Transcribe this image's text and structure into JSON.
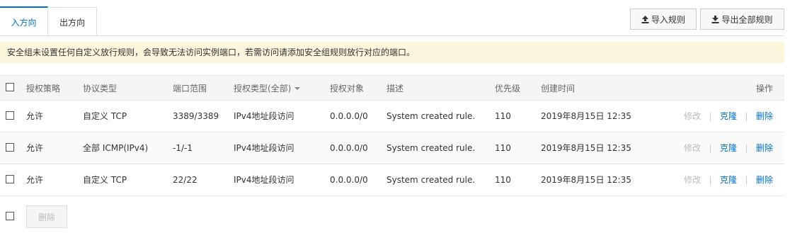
{
  "tabs": [
    {
      "label": "入方向",
      "active": true
    },
    {
      "label": "出方向",
      "active": false
    }
  ],
  "toolbar": {
    "import_label": "导入规则",
    "export_label": "导出全部规则"
  },
  "notice": {
    "text": "安全组未设置任何自定义放行规则，会导致无法访问实例端口，若需访问请添加安全组规则放行对应的端口。",
    "background": "#fdf5dc"
  },
  "table": {
    "headers": {
      "policy": "授权策略",
      "protocol": "协议类型",
      "port": "端口范围",
      "auth_type": "授权类型(全部)",
      "target": "授权对象",
      "desc": "描述",
      "priority": "优先级",
      "created": "创建时间",
      "ops": "操作"
    },
    "rows": [
      {
        "policy": "允许",
        "protocol": "自定义 TCP",
        "port": "3389/3389",
        "auth_type": "IPv4地址段访问",
        "target": "0.0.0.0/0",
        "desc": "System created rule.",
        "priority": "110",
        "created": "2019年8月15日 12:35",
        "edit": "修改",
        "clone": "克隆",
        "delete": "删除"
      },
      {
        "policy": "允许",
        "protocol": "全部 ICMP(IPv4)",
        "port": "-1/-1",
        "auth_type": "IPv4地址段访问",
        "target": "0.0.0.0/0",
        "desc": "System created rule.",
        "priority": "110",
        "created": "2019年8月15日 12:35",
        "edit": "修改",
        "clone": "克隆",
        "delete": "删除"
      },
      {
        "policy": "允许",
        "protocol": "自定义 TCP",
        "port": "22/22",
        "auth_type": "IPv4地址段访问",
        "target": "0.0.0.0/0",
        "desc": "System created rule.",
        "priority": "110",
        "created": "2019年8月15日 12:35",
        "edit": "修改",
        "clone": "克隆",
        "delete": "删除"
      }
    ]
  },
  "footer": {
    "bulk_delete_label": "删除"
  },
  "colors": {
    "accent": "#0070cc",
    "disabled": "#bbbbbb"
  }
}
